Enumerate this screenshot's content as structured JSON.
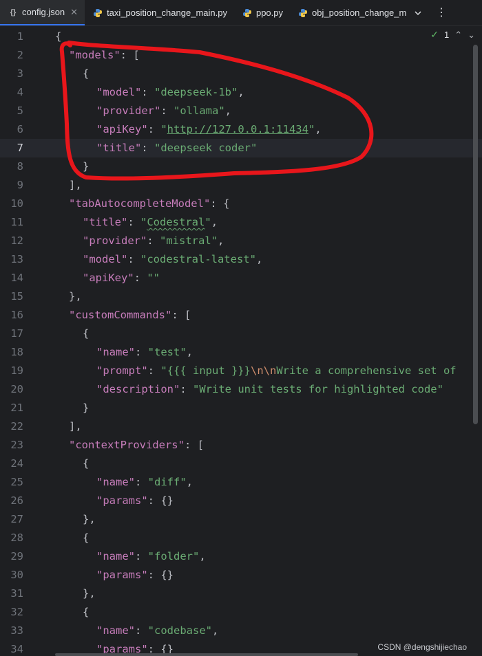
{
  "tabs": [
    {
      "label": "config.json",
      "active": true,
      "close": "✕",
      "icon": "json-file-icon"
    },
    {
      "label": "taxi_position_change_main.py",
      "icon": "python-file-icon"
    },
    {
      "label": "ppo.py",
      "icon": "python-file-icon"
    },
    {
      "label": "obj_position_change_m",
      "icon": "python-file-icon"
    }
  ],
  "inspection": {
    "count": "1"
  },
  "current_line": 7,
  "lines": [
    {
      "n": "1"
    },
    {
      "n": "2"
    },
    {
      "n": "3"
    },
    {
      "n": "4"
    },
    {
      "n": "5"
    },
    {
      "n": "6"
    },
    {
      "n": "7"
    },
    {
      "n": "8"
    },
    {
      "n": "9"
    },
    {
      "n": "10"
    },
    {
      "n": "11"
    },
    {
      "n": "12"
    },
    {
      "n": "13"
    },
    {
      "n": "14"
    },
    {
      "n": "15"
    },
    {
      "n": "16"
    },
    {
      "n": "17"
    },
    {
      "n": "18"
    },
    {
      "n": "19"
    },
    {
      "n": "20"
    },
    {
      "n": "21"
    },
    {
      "n": "22"
    },
    {
      "n": "23"
    },
    {
      "n": "24"
    },
    {
      "n": "25"
    },
    {
      "n": "26"
    },
    {
      "n": "27"
    },
    {
      "n": "28"
    },
    {
      "n": "29"
    },
    {
      "n": "30"
    },
    {
      "n": "31"
    },
    {
      "n": "32"
    },
    {
      "n": "33"
    },
    {
      "n": "34"
    }
  ],
  "code": {
    "open_brace": "{",
    "models_key": "\"models\"",
    "colon": ": ",
    "open_bracket": "[",
    "close_bracket": "]",
    "close_bracket_comma": "],",
    "obj_open": "{",
    "obj_close": "}",
    "obj_close_comma": "},",
    "comma": ",",
    "model_key": "\"model\"",
    "model_val": "\"deepseek-1b\"",
    "provider_key": "\"provider\"",
    "provider_val": "\"ollama\"",
    "apikey_key": "\"apiKey\"",
    "apikey_val_url": "http://127.0.0.1:11434",
    "quote": "\"",
    "title_key": "\"title\"",
    "title_val": "\"deepseek coder\"",
    "tab_key": "\"tabAutocompleteModel\"",
    "tab_title_val_open": "\"",
    "tab_title_val_word": "Codestral",
    "tab_provider_val": "\"mistral\"",
    "tab_model_val": "\"codestral-latest\"",
    "tab_apikey_val": "\"\"",
    "custom_key": "\"customCommands\"",
    "name_key": "\"name\"",
    "test_val": "\"test\"",
    "prompt_key": "\"prompt\"",
    "prompt_val_a": "\"{{{ input }}}",
    "prompt_val_esc": "\\n\\n",
    "prompt_val_b": "Write a comprehensive set of",
    "description_key": "\"description\"",
    "description_val": "\"Write unit tests for highlighted code\"",
    "context_key": "\"contextProviders\"",
    "diff_val": "\"diff\"",
    "params_key": "\"params\"",
    "empty_obj": "{}",
    "folder_val": "\"folder\"",
    "codebase_val": "\"codebase\""
  },
  "watermark": "CSDN @dengshijiechao",
  "colors": {
    "annotation": "#e8161b",
    "key": "#c77dbb",
    "string": "#6aab73",
    "accent": "#3574f0"
  }
}
